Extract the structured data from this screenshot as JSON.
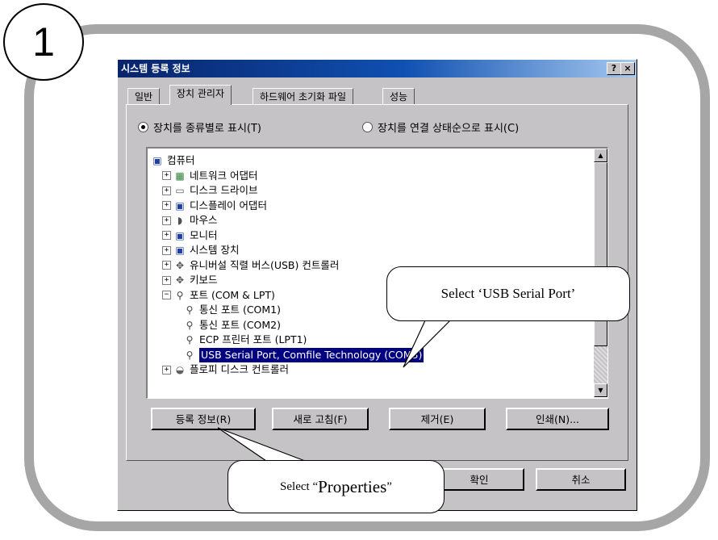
{
  "step_number": "1",
  "dialog": {
    "title": "시스템 등록 정보",
    "help_button": "?",
    "close_button": "×"
  },
  "tabs": [
    {
      "label": "일반"
    },
    {
      "label": "장치 관리자"
    },
    {
      "label": "하드웨어 초기화 파일"
    },
    {
      "label": "성능"
    }
  ],
  "view_options": {
    "by_type": "장치를 종류별로 표시(T)",
    "by_connection": "장치를 연결 상태순으로 표시(C)"
  },
  "tree": [
    {
      "label": "컴퓨터",
      "level": 0,
      "expander": "",
      "icon": "computer-icon",
      "glyph": "▣",
      "color": "#1e3fa0"
    },
    {
      "label": "네트워크 어댑터",
      "level": 1,
      "expander": "+",
      "icon": "network-adapter-icon",
      "glyph": "▦",
      "color": "#2e7d32"
    },
    {
      "label": "디스크 드라이브",
      "level": 1,
      "expander": "+",
      "icon": "disk-drive-icon",
      "glyph": "▭",
      "color": "#606060"
    },
    {
      "label": "디스플레이 어댑터",
      "level": 1,
      "expander": "+",
      "icon": "display-adapter-icon",
      "glyph": "▣",
      "color": "#1e3fa0"
    },
    {
      "label": "마우스",
      "level": 1,
      "expander": "+",
      "icon": "mouse-icon",
      "glyph": "◗",
      "color": "#505050"
    },
    {
      "label": "모니터",
      "level": 1,
      "expander": "+",
      "icon": "monitor-icon",
      "glyph": "▣",
      "color": "#1e3fa0"
    },
    {
      "label": "시스템 장치",
      "level": 1,
      "expander": "+",
      "icon": "system-devices-icon",
      "glyph": "▣",
      "color": "#1e3fa0"
    },
    {
      "label": "유니버설 직렬 버스(USB) 컨트롤러",
      "level": 1,
      "expander": "+",
      "icon": "usb-controller-icon",
      "glyph": "✥",
      "color": "#505050"
    },
    {
      "label": "키보드",
      "level": 1,
      "expander": "+",
      "icon": "keyboard-icon",
      "glyph": "✥",
      "color": "#505050"
    },
    {
      "label": "포트 (COM & LPT)",
      "level": 1,
      "expander": "−",
      "icon": "port-icon",
      "glyph": "⚲",
      "color": "#404040"
    },
    {
      "label": "통신 포트 (COM1)",
      "level": 2,
      "expander": "",
      "icon": "port-icon",
      "glyph": "⚲",
      "color": "#404040"
    },
    {
      "label": "통신 포트 (COM2)",
      "level": 2,
      "expander": "",
      "icon": "port-icon",
      "glyph": "⚲",
      "color": "#404040"
    },
    {
      "label": "ECP 프린터 포트 (LPT1)",
      "level": 2,
      "expander": "",
      "icon": "port-icon",
      "glyph": "⚲",
      "color": "#404040"
    },
    {
      "label": "USB Serial Port, Comfile Technology (COM3)",
      "level": 2,
      "expander": "",
      "icon": "port-icon",
      "glyph": "⚲",
      "color": "#404040",
      "selected": true
    },
    {
      "label": "플로피 디스크 컨트롤러",
      "level": 1,
      "expander": "+",
      "icon": "floppy-controller-icon",
      "glyph": "◒",
      "color": "#606060"
    }
  ],
  "buttons": {
    "properties": "등록 정보(R)",
    "refresh": "새로 고침(F)",
    "remove": "제거(E)",
    "print": "인쇄(N)...",
    "ok": "확인",
    "cancel": "취소"
  },
  "callouts": {
    "usb": "Select ‘USB Serial Port’",
    "properties_prefix": "Select “",
    "properties_word": "Properties",
    "properties_suffix": "”"
  }
}
